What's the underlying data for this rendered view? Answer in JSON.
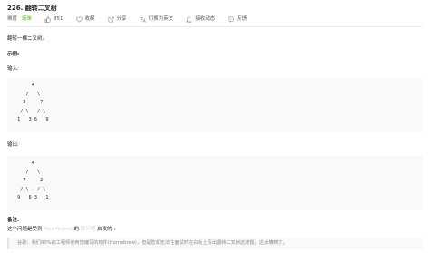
{
  "problem": {
    "title": "226. 翻转二叉树",
    "difficulty_label": "难度",
    "difficulty_value": "简单",
    "likes": "851",
    "favorite": "收藏",
    "share": "分享",
    "switch_language": "切换为英文",
    "follow": "接收动态",
    "feedback": "反馈"
  },
  "content": {
    "description": "翻转一棵二叉树。",
    "example_heading": "示例:",
    "input_label": "输入:",
    "input_tree": "      4\n    /   \\\n   2     7\n  / \\   / \\\n 1   3 6   9",
    "output_label": "输出:",
    "output_tree": "      4\n    /   \\\n   7     2\n  / \\   / \\\n 9   6 3   1",
    "note_heading": "备注:",
    "note_prefix": "这个问题是受到",
    "note_author": "Max Howell",
    "note_middle": "的",
    "note_link": "原问题",
    "note_suffix": "启发的 :",
    "quote": "谷歌：我们90%的工程师使用您编写的软件(Homebrew)，但是您却无法在面试时在白板上写出翻转二叉树这道题，这太糟糕了。"
  }
}
